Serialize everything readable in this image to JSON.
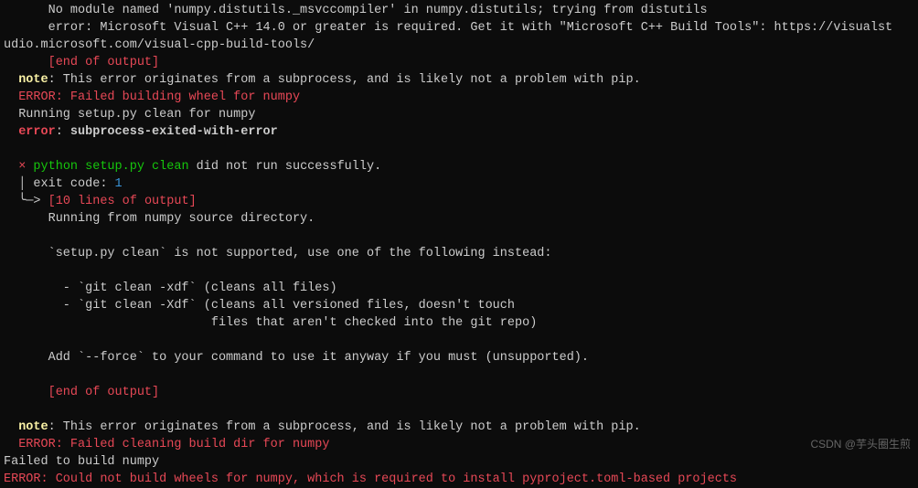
{
  "lines": {
    "l1": "      No module named 'numpy.distutils._msvccompiler' in numpy.distutils; trying from distutils",
    "l2a": "      error: Microsoft Visual C++ 14.0 or greater is required. Get it with \"Microsoft C++ Build Tools\": https://visualst",
    "l2b": "udio.microsoft.com/visual-cpp-build-tools/",
    "l3": "      [end of output]",
    "l4": "",
    "l5a": "  note",
    "l5b": ": This error originates from a subprocess, and is likely not a problem with pip.",
    "l6": "  ERROR: Failed building wheel for numpy",
    "l7": "  Running setup.py clean for numpy",
    "l8a": "  error",
    "l8b": ": ",
    "l8c": "subprocess-exited-with-error",
    "l9": "",
    "l10a": "  ",
    "l10b": "×",
    "l10c": " python setup.py clean",
    "l10d": " did not run successfully.",
    "l11a": "  │ ",
    "l11b": "exit code: ",
    "l11c": "1",
    "l12a": "  ╰─> ",
    "l12b": "[10 lines of output]",
    "l13": "      Running from numpy source directory.",
    "l14": "",
    "l15": "      `setup.py clean` is not supported, use one of the following instead:",
    "l16": "",
    "l17": "        - `git clean -xdf` (cleans all files)",
    "l18": "        - `git clean -Xdf` (cleans all versioned files, doesn't touch",
    "l19": "                            files that aren't checked into the git repo)",
    "l20": "",
    "l21": "      Add `--force` to your command to use it anyway if you must (unsupported).",
    "l22": "",
    "l23": "      [end of output]",
    "l24": "",
    "l25a": "  note",
    "l25b": ": This error originates from a subprocess, and is likely not a problem with pip.",
    "l26": "  ERROR: Failed cleaning build dir for numpy",
    "l27": "Failed to build numpy",
    "l28": "ERROR: Could not build wheels for numpy, which is required to install pyproject.toml-based projects"
  },
  "watermark": "CSDN @芋头圈生煎"
}
